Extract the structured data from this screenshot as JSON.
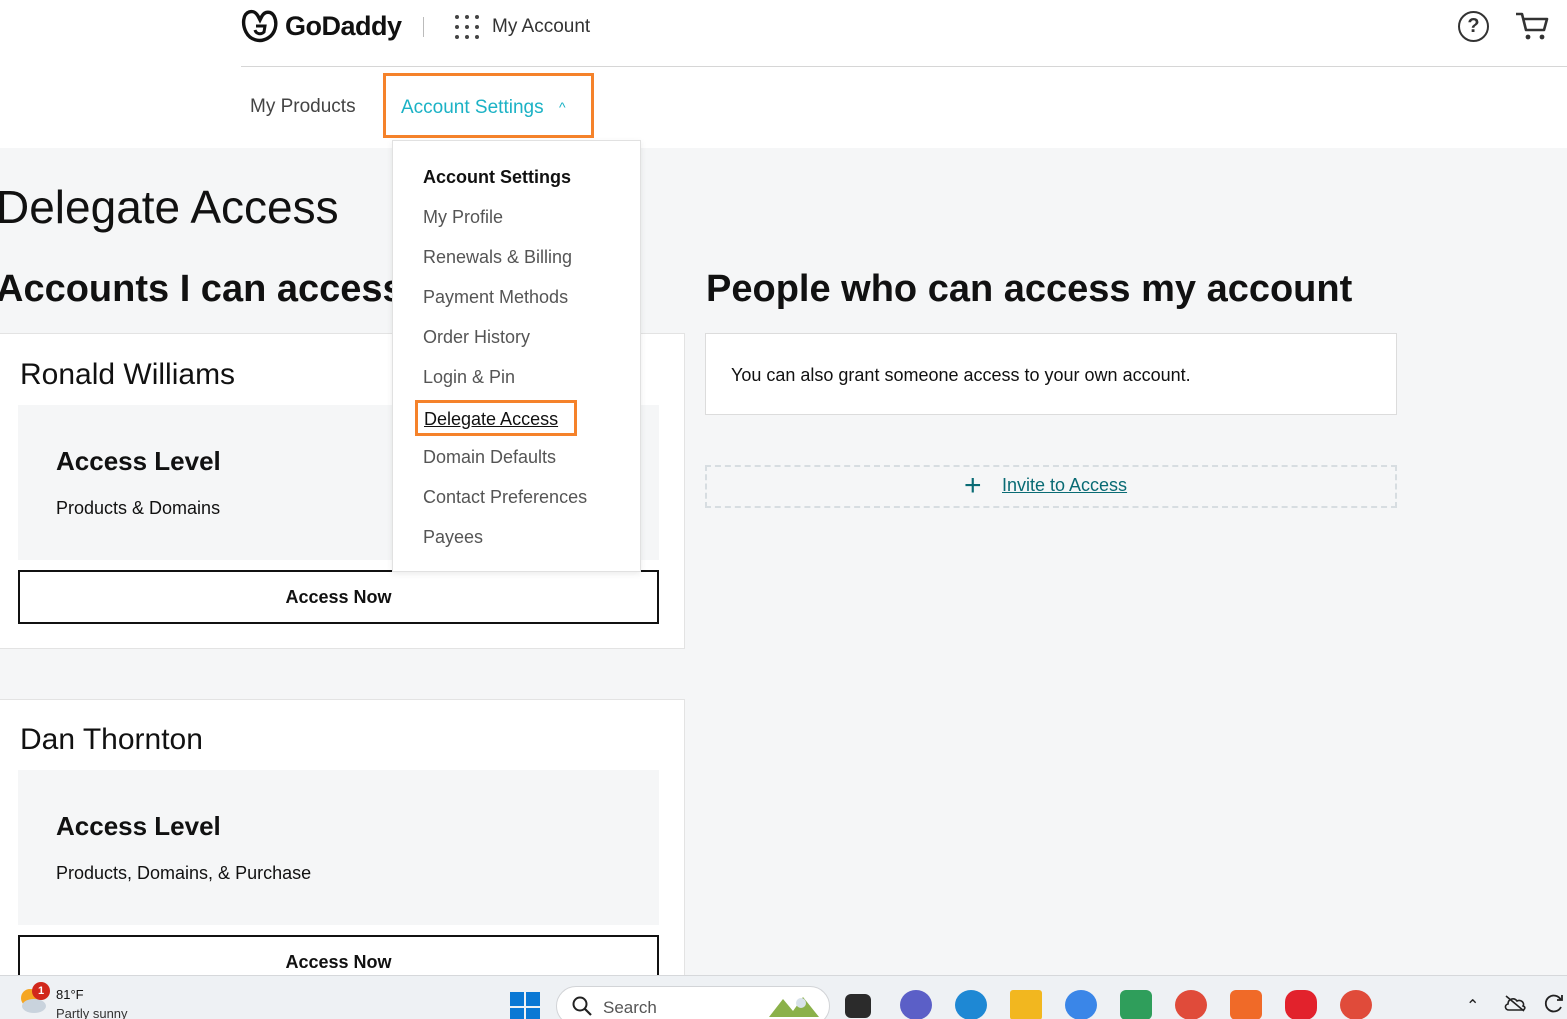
{
  "header": {
    "brand": "GoDaddy",
    "app_title": "My Account",
    "nav": {
      "products": "My Products",
      "settings": "Account Settings"
    }
  },
  "page": {
    "title": "Delegate Access",
    "left_heading": "Accounts I can access",
    "right_heading": "People who can access my account"
  },
  "accounts": [
    {
      "name": "Ronald Williams",
      "access_level_label": "Access Level",
      "access_level_value": "Products & Domains",
      "button": "Access Now"
    },
    {
      "name": "Dan Thornton",
      "access_level_label": "Access Level",
      "access_level_value": "Products, Domains, & Purchase",
      "button": "Access Now"
    }
  ],
  "grant": {
    "info": "You can also grant someone access to your own account.",
    "invite": "Invite to Access"
  },
  "dropdown": {
    "title": "Account Settings",
    "items": [
      "My Profile",
      "Renewals & Billing",
      "Payment Methods",
      "Order History",
      "Login & Pin",
      "Delegate Access",
      "Domain Defaults",
      "Contact Preferences",
      "Payees"
    ],
    "active_index": 5
  },
  "taskbar": {
    "weather_badge": "1",
    "temperature": "81°F",
    "condition": "Partly sunny",
    "search_placeholder": "Search"
  },
  "colors": {
    "accent": "#1bb2c5",
    "highlight": "#f5822a",
    "link": "#096b74"
  }
}
